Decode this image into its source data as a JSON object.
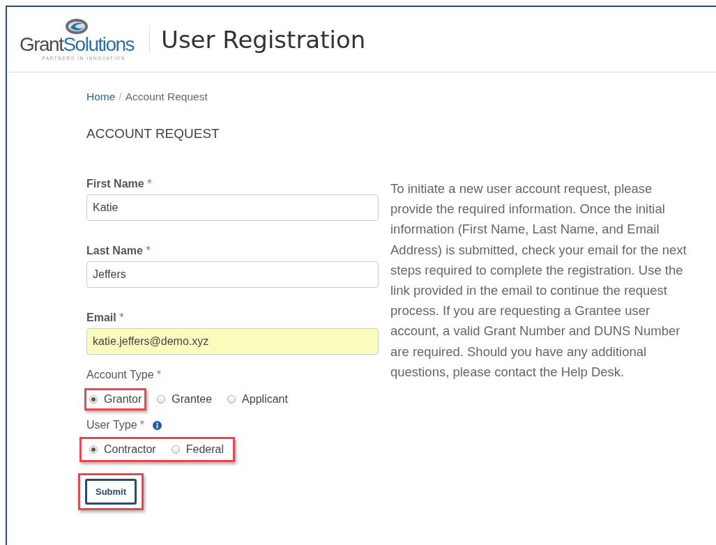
{
  "header": {
    "logo": {
      "name_first": "Grant",
      "name_second": "Solutions",
      "tagline": "PARTNERS IN INNOVATION"
    },
    "title": "User Registration"
  },
  "breadcrumb": [
    {
      "label": "Home",
      "kind": "link"
    },
    {
      "label": "/",
      "kind": "separator"
    },
    {
      "label": "Account Request",
      "kind": "current"
    }
  ],
  "heading": "ACCOUNT REQUEST",
  "fields": [
    {
      "label": "First Name",
      "required": "*",
      "value": "Katie",
      "autofilled": false
    },
    {
      "label": "Last Name",
      "required": "*",
      "value": "Jeffers",
      "autofilled": false
    },
    {
      "label": "Email",
      "required": "*",
      "value": "katie.jeffers@demo.xyz",
      "autofilled": true
    }
  ],
  "account_type": {
    "label": "Account Type",
    "required": "*",
    "info": false,
    "highlighted": false,
    "options": [
      {
        "label": "Grantor",
        "selected": true,
        "highlighted": true
      },
      {
        "label": "Grantee",
        "selected": false,
        "highlighted": false
      },
      {
        "label": "Applicant",
        "selected": false,
        "highlighted": false
      }
    ]
  },
  "user_type": {
    "label": "User Type",
    "required": "*",
    "info": true,
    "highlighted": true,
    "options": [
      {
        "label": "Contractor",
        "selected": true,
        "highlighted": false
      },
      {
        "label": "Federal",
        "selected": false,
        "highlighted": false
      }
    ]
  },
  "submit": {
    "label": "Submit",
    "highlighted": true
  },
  "description": "To initiate a new user account request, please provide the required information. Once the initial information (First Name, Last Name, and Email Address) is submitted, check your email for the next steps required to complete the registration. Use the link provided in the email to continue the request process. If you are requesting a Grantee user account, a valid Grant Number and DUNS Number are required. Should you have any additional questions, please contact the Help Desk."
}
